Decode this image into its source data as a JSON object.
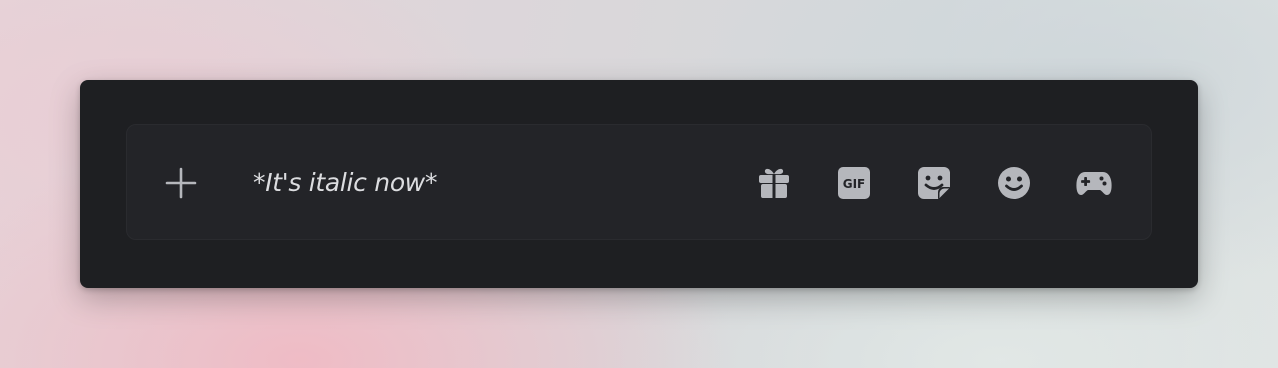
{
  "composer": {
    "message_text": "*It's italic now*",
    "attach_icon": "plus-icon",
    "tools": [
      {
        "name": "gift-icon",
        "label": ""
      },
      {
        "name": "gif-icon",
        "label": "GIF"
      },
      {
        "name": "sticker-icon",
        "label": ""
      },
      {
        "name": "emoji-icon",
        "label": ""
      },
      {
        "name": "gamepad-icon",
        "label": ""
      }
    ]
  },
  "colors": {
    "window_bg": "#1e1f22",
    "composer_bg": "#232428",
    "icon": "#b5b7bc",
    "text": "#dcdde0"
  }
}
